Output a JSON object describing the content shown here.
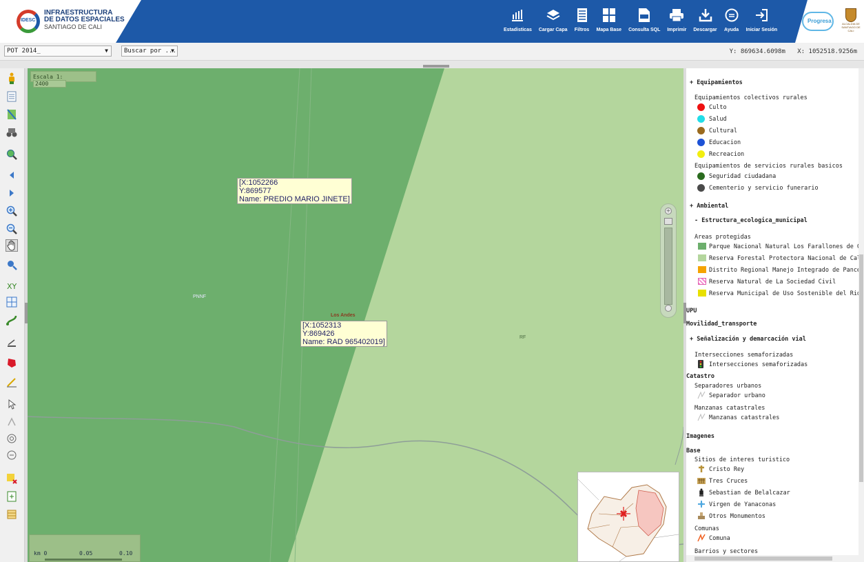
{
  "header": {
    "logo": {
      "badge": "IDESC",
      "line1": "INFRAESTRUCTURA",
      "line2": "DE DATOS ESPACIALES",
      "line3": "SANTIAGO DE CALI"
    },
    "tools": [
      {
        "label": "Estadisticas",
        "icon": "bar-chart-icon"
      },
      {
        "label": "Cargar Capa",
        "icon": "layers-icon"
      },
      {
        "label": "Filtros",
        "icon": "filter-icon"
      },
      {
        "label": "Mapa Base",
        "icon": "basemap-icon"
      },
      {
        "label": "Consulta SQL",
        "icon": "sql-icon"
      },
      {
        "label": "Imprimir",
        "icon": "printer-icon"
      },
      {
        "label": "Descargar",
        "icon": "download-icon"
      },
      {
        "label": "Ayuda",
        "icon": "help-icon"
      },
      {
        "label": "Iniciar Sesión",
        "icon": "login-icon"
      }
    ],
    "partner_logo": "Progresa",
    "alcaldia_logo": "ALCALDIA DE SANTIAGO DE CALI"
  },
  "controls": {
    "pot_select": "POT 2014_",
    "search_select": "Buscar por ...",
    "coord_y": "Y: 869634.6098m",
    "coord_x": "X: 1052518.9256m"
  },
  "map": {
    "scale_label": "Escala 1:",
    "scale_value": "2400",
    "popup1": {
      "x": "[X:1052266",
      "y": " Y:869577",
      "name": " Name: PREDIO MARIO JINETE]"
    },
    "popup2": {
      "x": "[X:1052313",
      "y": " Y:869426",
      "name": " Name: RAD 965402019]"
    },
    "labels": {
      "pnnf": "PNNF",
      "los_andes": "Los Andes",
      "rf": "RF"
    },
    "scalebar": {
      "unit": "km 0",
      "mid": "0.05",
      "end": "0.10"
    },
    "colors": {
      "dark_green": "#6daf6d",
      "light_green": "#b4d69d"
    }
  },
  "legend": {
    "equipamientos": "+ Equipamientos",
    "colectivos_title": "Equipamientos colectivos rurales",
    "colectivos": [
      {
        "label": "Culto",
        "color": "#ee1111"
      },
      {
        "label": "Salud",
        "color": "#22dde8"
      },
      {
        "label": "Cultural",
        "color": "#9a6a1e"
      },
      {
        "label": "Educacion",
        "color": "#1d52d6"
      },
      {
        "label": "Recreacion",
        "color": "#f2ee10"
      }
    ],
    "servicios_title": "Equipamientos de servicios rurales basicos",
    "servicios": [
      {
        "label": "Seguridad ciudadana",
        "color": "#2a6b1e"
      },
      {
        "label": "Cementerio y servicio funerario",
        "color": "#4a4a4a"
      }
    ],
    "ambiental": "+ Ambiental",
    "estructura": "- Estructura_ecologica_municipal",
    "areas_title": "Areas protegidas",
    "areas": [
      {
        "label": "Parque Nacional Natural Los Farallones de Cali",
        "color": "#6daf6d"
      },
      {
        "label": "Reserva Forestal Protectora Nacional de Cali",
        "color": "#b4d69d"
      },
      {
        "label": "Distrito Regional Manejo Integrado de Pance",
        "color": "#f5a300"
      },
      {
        "label": "Reserva Natural de La Sociedad Civil",
        "color": "#f48ad0"
      },
      {
        "label": "Reserva Municipal de Uso Sostenible del Rio Melen",
        "color": "#e8e000"
      }
    ],
    "upu": "UPU",
    "movilidad": "Movilidad_transporte",
    "senalizacion": "+ Señalización y demarcación vial",
    "intersecciones_title": "Intersecciones semaforizadas",
    "intersecciones_item": "Intersecciones semaforizadas",
    "catastro": "Catastro",
    "separadores_title": "Separadores urbanos",
    "separadores_item": "Separador urbano",
    "manzanas_title": "Manzanas catastrales",
    "manzanas_item": "Manzanas catastrales",
    "imagenes": "Imagenes",
    "base": "Base",
    "sitios_title": "Sitios de interes turistico",
    "sitios": [
      "Cristo Rey",
      "Tres Cruces",
      "Sebastian de Belalcazar",
      "Virgen de Yanaconas",
      "Otros Monumentos"
    ],
    "comunas_title": "Comunas",
    "comunas_item": "Comuna",
    "barrios_title": "Barrios y sectores"
  }
}
